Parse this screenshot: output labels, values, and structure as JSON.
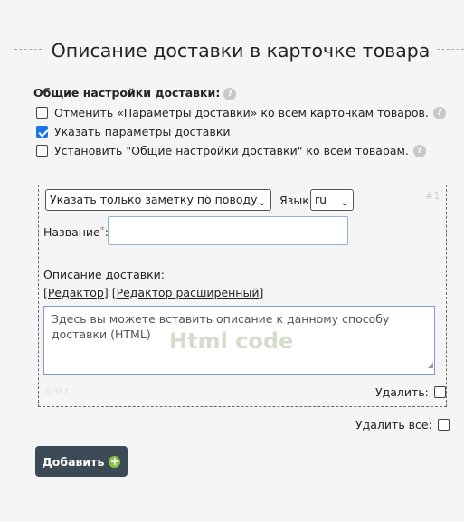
{
  "page": {
    "title": "Описание доставки в карточке товара"
  },
  "settings": {
    "label": "Общие настройки доставки",
    "options": [
      {
        "label": "Отменить «Параметры доставки» ко всем карточкам товаров.",
        "checked": false
      },
      {
        "label": "Указать параметры доставки",
        "checked": true
      },
      {
        "label": "Установить \"Общие настройки доставки\" ко всем товарам.",
        "checked": false
      }
    ]
  },
  "item": {
    "number": "#1",
    "type_select": "Указать только заметку по поводу",
    "lang_label": "Язык",
    "lang_select": "ru",
    "name_label": "Название",
    "name_required": "*",
    "name_value": "",
    "desc_label": "Описание доставки:",
    "editor_link": "[Редактор]",
    "editor_ext_link": "[Редактор расширенный]",
    "desc_placeholder": "Здесь вы можете вставить описание к данному способу доставки (HTML)",
    "desc_watermark": "Html code",
    "char_counter": "0/387",
    "delete_label": "Удалить:"
  },
  "delete_all_label": "Удалить все:",
  "add_button": "Добавить",
  "icons": {
    "help": "question-icon",
    "plus": "plus-circle-icon",
    "chevron": "chevron-down-icon"
  },
  "colors": {
    "button_bg": "#3c4a55",
    "plus": "#8bc34a",
    "checkbox_checked": "#1a73e8"
  }
}
